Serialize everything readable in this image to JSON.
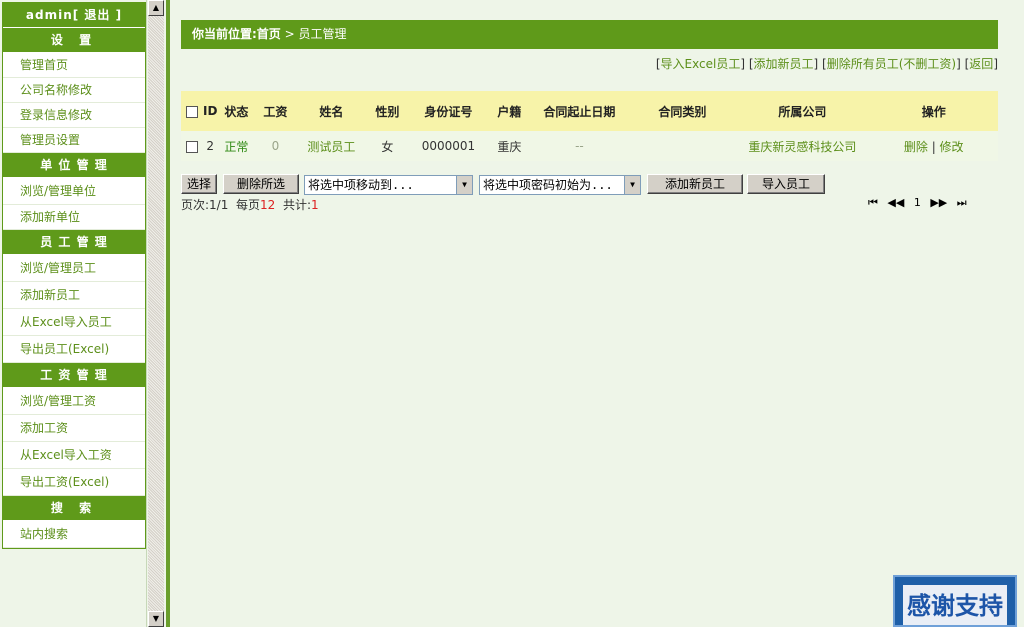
{
  "sidebar": {
    "user": "admin[ 退出 ]",
    "sections": [
      {
        "title": "设  置",
        "items": [
          "管理首页",
          "公司名称修改",
          "登录信息修改",
          "管理员设置"
        ]
      },
      {
        "title": "单 位 管 理",
        "items": [
          "浏览/管理单位",
          "添加新单位"
        ]
      },
      {
        "title": "员 工 管 理",
        "items": [
          "浏览/管理员工",
          "添加新员工",
          "从Excel导入员工",
          "导出员工(Excel)"
        ]
      },
      {
        "title": "工 资 管 理",
        "items": [
          "浏览/管理工资",
          "添加工资",
          "从Excel导入工资",
          "导出工资(Excel)"
        ]
      },
      {
        "title": "搜  索",
        "items": [
          "站内搜索"
        ]
      }
    ]
  },
  "breadcrumb": {
    "prefix": "你当前位置:首页",
    "current": "> 员工管理"
  },
  "toplinks": [
    "导入Excel员工",
    "添加新员工",
    "删除所有员工(不删工资)",
    "返回"
  ],
  "table": {
    "headers": [
      "ID",
      "状态",
      "工资",
      "姓名",
      "性别",
      "身份证号",
      "户籍",
      "合同起止日期",
      "合同类别",
      "所属公司",
      "操作"
    ],
    "rows": [
      {
        "id": "2",
        "status": "正常",
        "salary": "0",
        "name": "测试员工",
        "gender": "女",
        "idcard": "0000001",
        "hukou": "重庆",
        "contract_dates": "--",
        "contract_type": "",
        "company": "重庆新灵感科技公司",
        "delete": "删除",
        "edit": "修改"
      }
    ]
  },
  "controls": {
    "select_btn": "选择",
    "delete_selected": "删除所选",
    "move_select": "将选中项移动到...",
    "password_select": "将选中项密码初始为...",
    "add_employee": "添加新员工",
    "import_employee": "导入员工"
  },
  "pageinfo": {
    "page_label": "页次:",
    "page": "1/1",
    "per_label": "每页",
    "per": "12",
    "total_label": "共计:",
    "total": "1"
  },
  "pager": {
    "first": "⏮",
    "prev": "◀◀",
    "current": "1",
    "next": "▶▶",
    "last": "⏭"
  },
  "badge": {
    "text": "感谢支持"
  },
  "colors": {
    "accent": "#5f9a1a",
    "header_bg": "#f7f3a9",
    "row_bg": "#f0f7e6",
    "link": "#5c8f1a"
  }
}
